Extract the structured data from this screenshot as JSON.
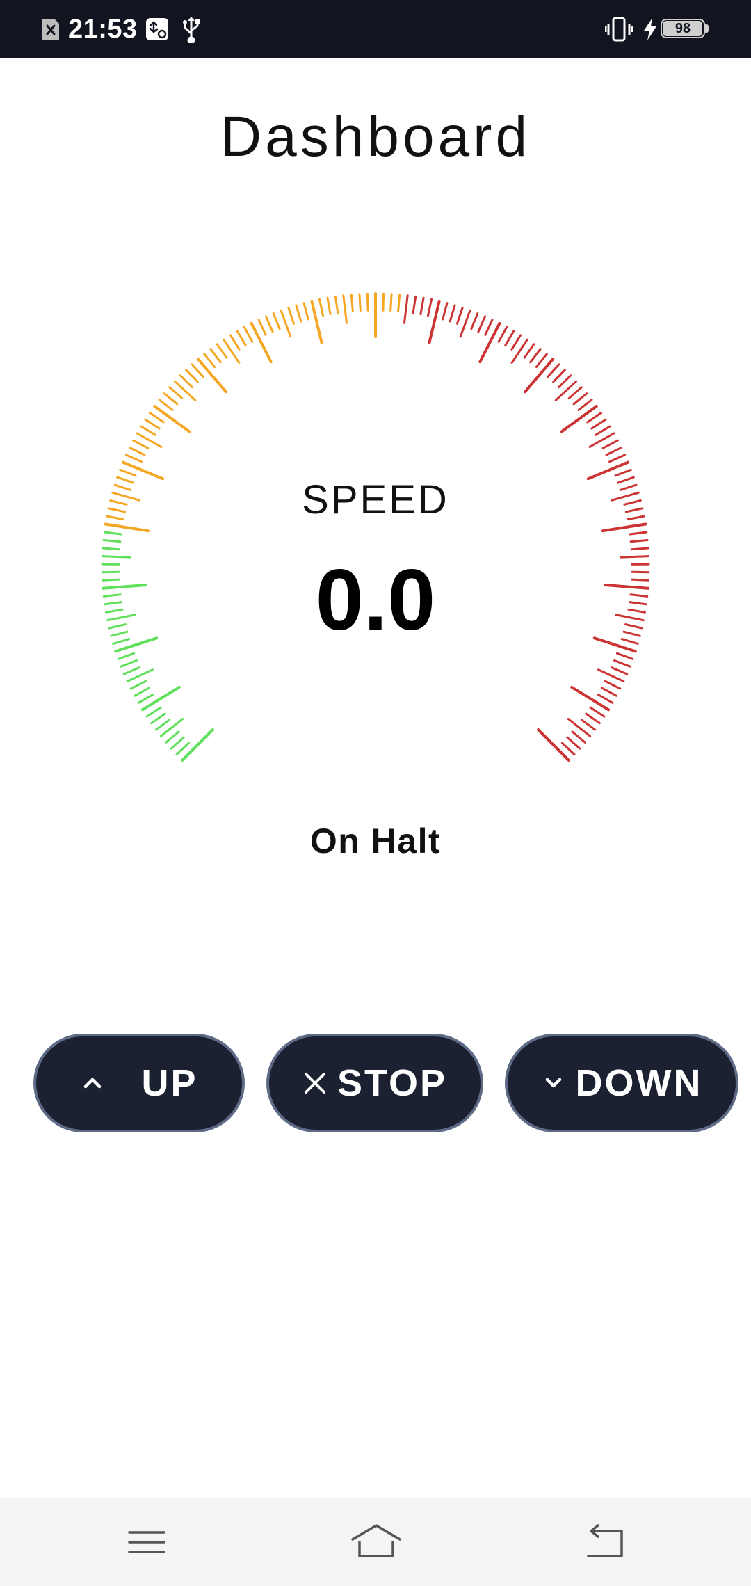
{
  "status_bar": {
    "time": "21:53",
    "battery_level": "98",
    "icons": [
      "sim-blocked-icon",
      "usb-debug-icon",
      "usb-icon",
      "vibrate-icon",
      "charging-icon",
      "battery-icon"
    ]
  },
  "page": {
    "title": "Dashboard"
  },
  "gauge": {
    "label": "SPEED",
    "value": "0.0",
    "zone_colors": {
      "low": "#5ee05a",
      "mid": "#f5a623",
      "high": "#cc3333"
    }
  },
  "status": {
    "text": "On Halt"
  },
  "controls": {
    "up_label": "UP",
    "stop_label": "STOP",
    "down_label": "DOWN",
    "up_icon": "chevron-up-icon",
    "stop_icon": "close-icon",
    "down_icon": "chevron-down-icon"
  },
  "nav_bar": {
    "items": [
      "menu-icon",
      "home-icon",
      "back-icon"
    ]
  },
  "colors": {
    "status_bar_bg": "#12151f",
    "button_bg": "#1c2131",
    "button_border": "#5e6b86",
    "nav_bar_bg": "#f4f4f4"
  }
}
